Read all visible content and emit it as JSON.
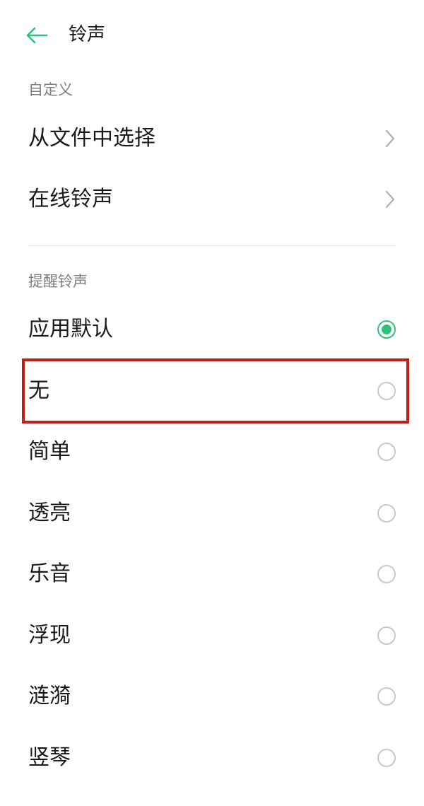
{
  "header": {
    "title": "铃声",
    "accent_color": "#2ec27e",
    "back_icon": "arrow-left-icon"
  },
  "custom_section": {
    "label": "自定义",
    "items": [
      {
        "label": "从文件中选择",
        "icon": "chevron-right-icon"
      },
      {
        "label": "在线铃声",
        "icon": "chevron-right-icon"
      }
    ]
  },
  "reminder_section": {
    "label": "提醒铃声",
    "selected": "应用默认",
    "items": [
      {
        "label": "应用默认",
        "checked": true
      },
      {
        "label": "无",
        "checked": false
      },
      {
        "label": "简单",
        "checked": false
      },
      {
        "label": "透亮",
        "checked": false
      },
      {
        "label": "乐音",
        "checked": false
      },
      {
        "label": "浮现",
        "checked": false
      },
      {
        "label": "涟漪",
        "checked": false
      },
      {
        "label": "竖琴",
        "checked": false
      }
    ]
  },
  "highlight": {
    "target": "无",
    "color": "#c0201c"
  }
}
